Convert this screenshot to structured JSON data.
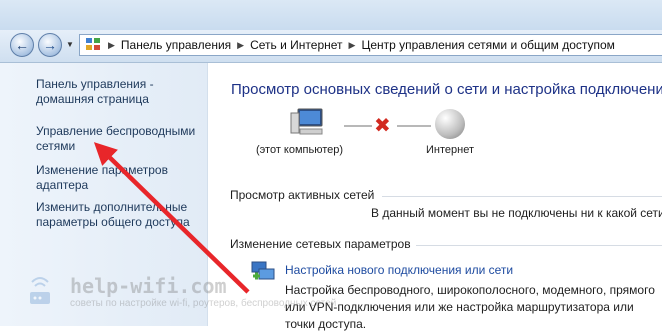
{
  "address_bar": {
    "breadcrumbs": [
      "Панель управления",
      "Сеть и Интернет",
      "Центр управления сетями и общим доступом"
    ]
  },
  "sidebar": {
    "links": [
      {
        "line1": "Панель управления -",
        "line2": "домашняя страница"
      },
      {
        "line1": "Управление беспроводными",
        "line2": "сетями"
      },
      {
        "line1": "Изменение параметров",
        "line2": "адаптера"
      },
      {
        "line1": "Изменить дополнительные",
        "line2": "параметры общего доступа"
      }
    ]
  },
  "main": {
    "title": "Просмотр основных сведений о сети и настройка подключений",
    "network_map": {
      "computer_label": "(этот компьютер)",
      "internet_label": "Интернет",
      "status_color": "#d22a20"
    },
    "active_networks": {
      "heading": "Просмотр активных сетей",
      "message": "В данный момент вы не подключены ни к какой сети."
    },
    "change_settings": {
      "heading": "Изменение сетевых параметров",
      "setup_link": "Настройка нового подключения или сети",
      "setup_description": "Настройка беспроводного, широкополосного, модемного, прямого или VPN-подключения или же настройка маршрутизатора или точки доступа."
    }
  },
  "watermark": {
    "brand": "help-wifi.com",
    "tagline": "советы по настройке wi-fi, роутеров, беспроводных сетей"
  },
  "colors": {
    "link": "#1e395b",
    "title": "#1e3287",
    "arrow": "#e8262a"
  }
}
